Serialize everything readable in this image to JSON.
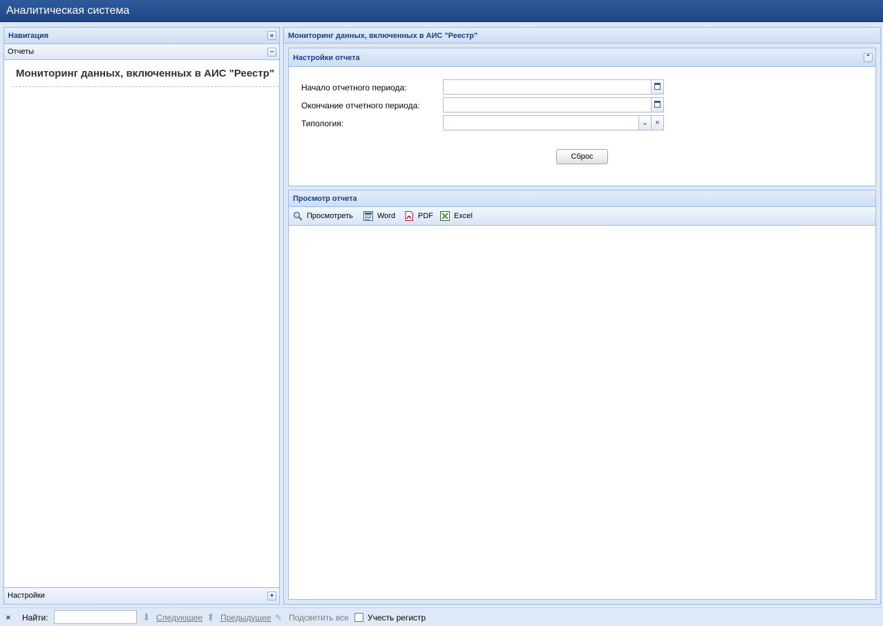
{
  "app": {
    "title": "Аналитическая система"
  },
  "nav": {
    "title": "Навигация",
    "reports_section": "Отчеты",
    "report_link": "Мониторинг данных, включенных в АИС \"Реестр\"",
    "settings_section": "Настройки"
  },
  "main": {
    "title": "Мониторинг данных, включенных в АИС \"Реестр\"",
    "settings_panel": {
      "title": "Настройки отчета",
      "start_label": "Начало отчетного периода:",
      "start_value": "",
      "end_label": "Окончание отчетного периода:",
      "end_value": "",
      "typology_label": "Типология:",
      "typology_value": "",
      "reset_button": "Сброс"
    },
    "view_panel": {
      "title": "Просмотр отчета",
      "view_button": "Просмотреть",
      "word_button": "Word",
      "pdf_button": "PDF",
      "excel_button": "Excel"
    }
  },
  "findbar": {
    "close": "×",
    "find_label": "Найти:",
    "find_value": "",
    "next_label": "Следующее",
    "prev_label": "Предыдущее",
    "highlight_label": "Подсветить все",
    "match_case_label": "Учесть регистр",
    "match_case_checked": false
  }
}
